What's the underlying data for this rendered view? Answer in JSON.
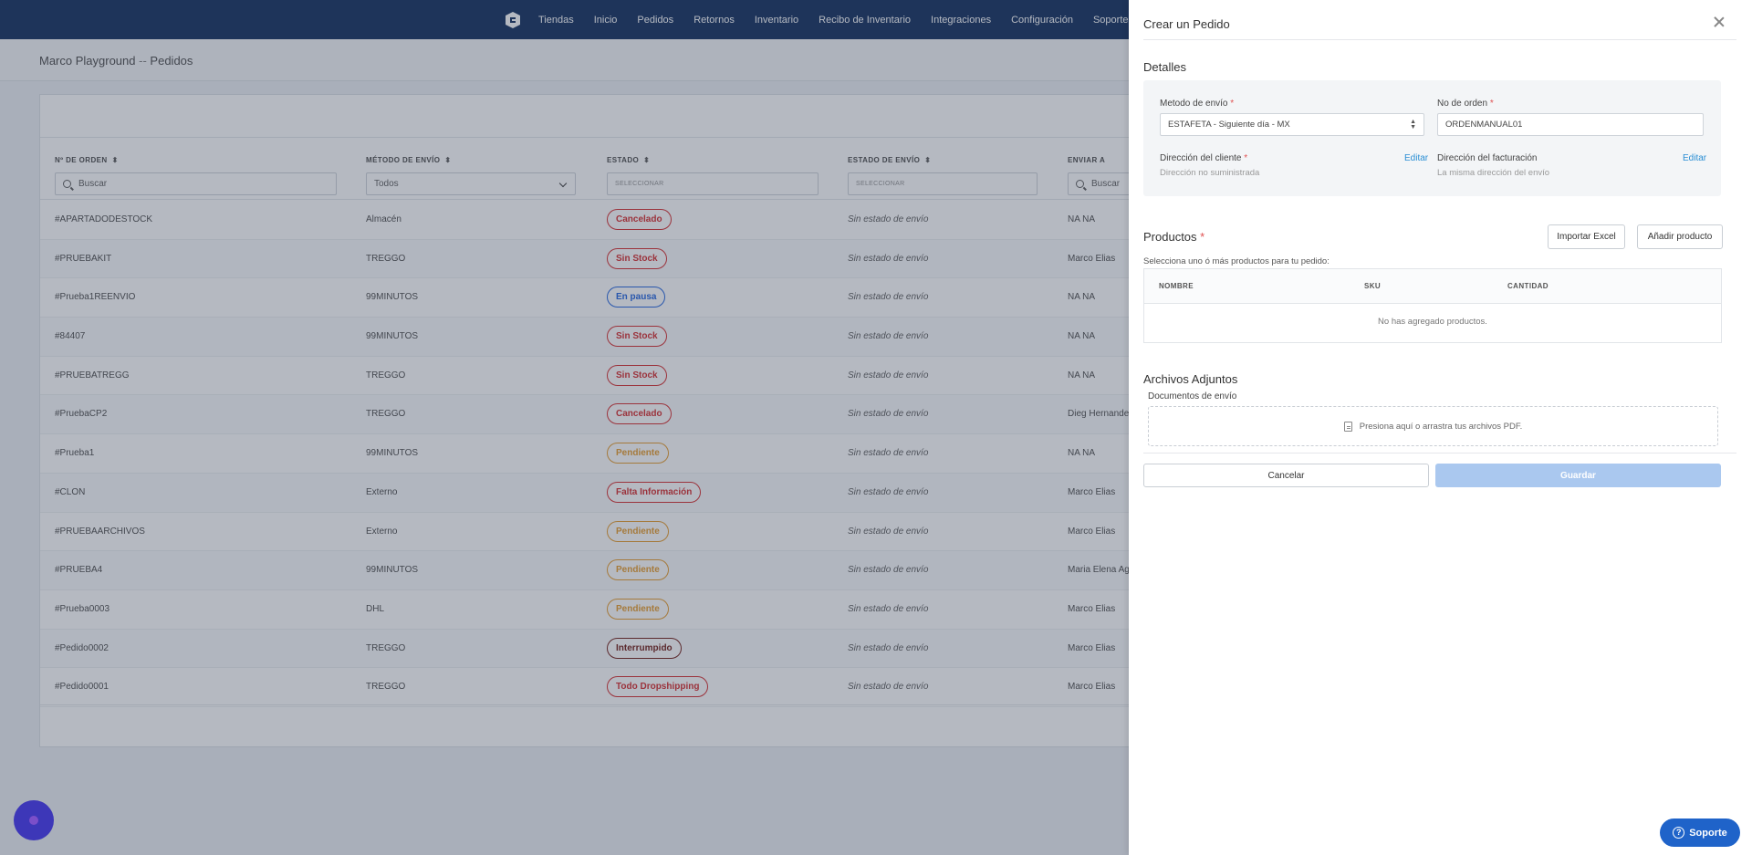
{
  "nav": {
    "items": [
      "Tiendas",
      "Inicio",
      "Pedidos",
      "Retornos",
      "Inventario",
      "Recibo de Inventario",
      "Integraciones",
      "Configuración",
      "Soporte"
    ]
  },
  "page": {
    "breadcrumb_store": "Marco Playground",
    "breadcrumb_sep": "--",
    "breadcrumb_page": "Pedidos"
  },
  "table": {
    "headers": {
      "order": "Nº DE ORDEN",
      "method": "MÉTODO DE ENVÍO",
      "status": "ESTADO",
      "ship_status": "ESTADO DE ENVÍO",
      "send_to": "ENVIAR A"
    },
    "filters": {
      "order_placeholder": "Buscar",
      "method_value": "Todos",
      "status_placeholder": "SELECCIONAR",
      "ship_status_placeholder": "SELECCIONAR",
      "send_to_placeholder": "Buscar"
    },
    "rows": [
      {
        "order": "#APARTADODESTOCK",
        "method": "Almacén",
        "status": "Cancelado",
        "status_color": "red",
        "ship": "Sin estado de envío",
        "to": "NA NA"
      },
      {
        "order": "#PRUEBAKIT",
        "method": "TREGGO",
        "status": "Sin Stock",
        "status_color": "red",
        "ship": "Sin estado de envío",
        "to": "Marco Elias"
      },
      {
        "order": "#Prueba1REENVIO",
        "method": "99MINUTOS",
        "status": "En pausa",
        "status_color": "blue",
        "ship": "Sin estado de envío",
        "to": "NA NA"
      },
      {
        "order": "#84407",
        "method": "99MINUTOS",
        "status": "Sin Stock",
        "status_color": "red",
        "ship": "Sin estado de envío",
        "to": "NA NA"
      },
      {
        "order": "#PRUEBATREGG",
        "method": "TREGGO",
        "status": "Sin Stock",
        "status_color": "red",
        "ship": "Sin estado de envío",
        "to": "NA NA"
      },
      {
        "order": "#PruebaCP2",
        "method": "TREGGO",
        "status": "Cancelado",
        "status_color": "red",
        "ship": "Sin estado de envío",
        "to": "Dieg Hernandez"
      },
      {
        "order": "#Prueba1",
        "method": "99MINUTOS",
        "status": "Pendiente",
        "status_color": "orange",
        "ship": "Sin estado de envío",
        "to": "NA NA"
      },
      {
        "order": "#CLON",
        "method": "Externo",
        "status": "Falta Información",
        "status_color": "red",
        "ship": "Sin estado de envío",
        "to": "Marco Elias"
      },
      {
        "order": "#PRUEBAARCHIVOS",
        "method": "Externo",
        "status": "Pendiente",
        "status_color": "orange",
        "ship": "Sin estado de envío",
        "to": "Marco Elias"
      },
      {
        "order": "#PRUEBA4",
        "method": "99MINUTOS",
        "status": "Pendiente",
        "status_color": "orange",
        "ship": "Sin estado de envío",
        "to": "Maria Elena Agu"
      },
      {
        "order": "#Prueba0003",
        "method": "DHL",
        "status": "Pendiente",
        "status_color": "orange",
        "ship": "Sin estado de envío",
        "to": "Marco Elias"
      },
      {
        "order": "#Pedido0002",
        "method": "TREGGO",
        "status": "Interrumpido",
        "status_color": "dark",
        "ship": "Sin estado de envío",
        "to": "Marco Elias"
      },
      {
        "order": "#Pedido0001",
        "method": "TREGGO",
        "status": "Todo Dropshipping",
        "status_color": "red",
        "ship": "Sin estado de envío",
        "to": "Marco Elias"
      }
    ]
  },
  "panel": {
    "title": "Crear un Pedido",
    "details_title": "Detalles",
    "shipping_method_label": "Metodo de envío",
    "shipping_method_value": "ESTAFETA - Siguiente día - MX",
    "order_no_label": "No de orden",
    "order_no_value": "ORDENMANUAL01",
    "client_address_label": "Dirección del cliente",
    "client_address_value": "Dirección no suministrada",
    "billing_address_label": "Dirección del facturación",
    "billing_address_value": "La misma dirección del envío",
    "edit_label": "Editar",
    "required_mark": "*",
    "products_title": "Productos",
    "products_hint": "Selecciona uno ó más productos para tu pedido:",
    "import_excel": "Importar Excel",
    "add_product": "Añadir producto",
    "col_name": "NOMBRE",
    "col_sku": "SKU",
    "col_qty": "CANTIDAD",
    "empty_products": "No has agregado productos.",
    "attachments_title": "Archivos Adjuntos",
    "shipping_docs_label": "Documentos de envío",
    "dropzone_text": "Presiona aquí o arrastra tus archivos PDF.",
    "cancel": "Cancelar",
    "save": "Guardar"
  },
  "support": {
    "label": "Soporte"
  },
  "colors": {
    "nav_bg": "#1e3a66",
    "accent": "#1f63c9",
    "save_disabled": "#aac8ef"
  }
}
